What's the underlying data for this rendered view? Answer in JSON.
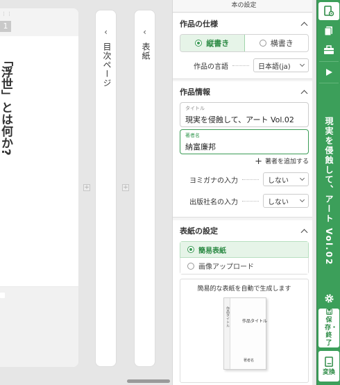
{
  "canvas": {
    "page_number": "1",
    "page_text": "「浮世」とは何か?",
    "toc_label": "目次ページ",
    "cover_label": "表紙"
  },
  "panel": {
    "title": "本の設定",
    "spec": {
      "heading": "作品の仕様",
      "vertical": "縦書き",
      "horizontal": "横書き",
      "selected": "vertical",
      "language_label": "作品の言語",
      "language_value": "日本語(ja)"
    },
    "info": {
      "heading": "作品情報",
      "title_label": "タイトル",
      "title_value": "現実を侵蝕して、アート Vol.02",
      "author_label": "著者名",
      "author_value": "納富廉邦",
      "add_author": "著者を追加する",
      "furigana_label": "ヨミガナの入力",
      "furigana_value": "しない",
      "publisher_label": "出版社名の入力",
      "publisher_value": "しない"
    },
    "cover": {
      "heading": "表紙の設定",
      "simple": "簡易表紙",
      "upload": "画像アップロード",
      "caption": "簡易的な表紙を自動で生成します",
      "book_title": "作品タイトル",
      "book_spine": "作品タイトル",
      "book_author": "著者名"
    }
  },
  "toolbar": {
    "vertical_title": "現実を侵蝕して、アート Vol.02",
    "save_label": "保存・終了",
    "convert_label": "変換",
    "icons": [
      "book-settings-icon",
      "pages-icon",
      "toolbox-icon",
      "preview-play-icon",
      "gear-icon",
      "save-icon",
      "convert-book-icon"
    ],
    "colors": {
      "bar": "#3c9f5a",
      "accent": "#2e8b46"
    }
  }
}
